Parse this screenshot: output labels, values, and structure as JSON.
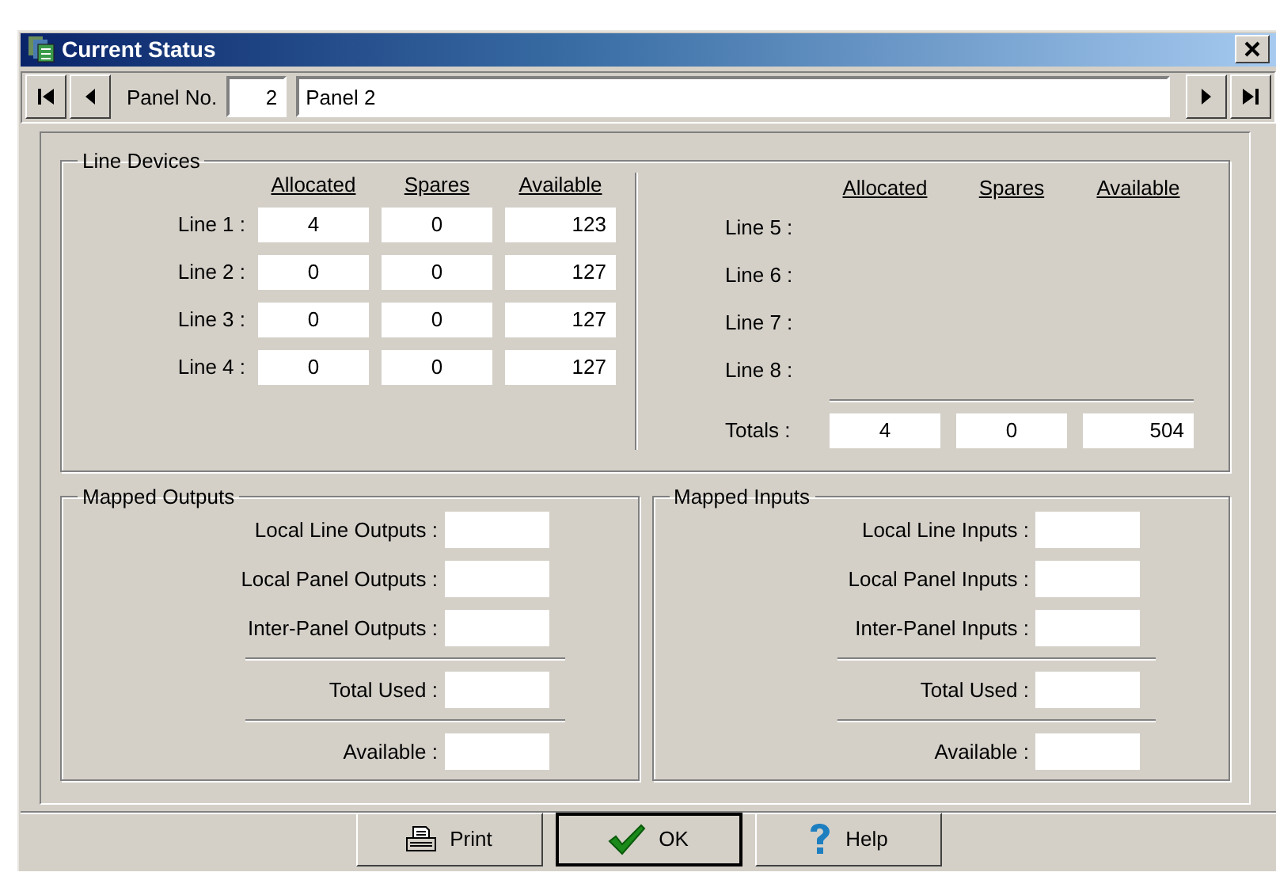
{
  "window": {
    "title": "Current Status"
  },
  "navigator": {
    "label": "Panel No.",
    "number": "2",
    "name": "Panel 2"
  },
  "line_devices": {
    "title": "Line Devices",
    "columns_left": [
      "Allocated",
      "Spares",
      "Available"
    ],
    "lines_left": [
      {
        "label": "Line 1 :",
        "values": [
          "4",
          "0",
          "123"
        ]
      },
      {
        "label": "Line 2 :",
        "values": [
          "0",
          "0",
          "127"
        ]
      },
      {
        "label": "Line 3 :",
        "values": [
          "0",
          "0",
          "127"
        ]
      },
      {
        "label": "Line 4 :",
        "values": [
          "0",
          "0",
          "127"
        ]
      }
    ],
    "columns_right": [
      "Allocated",
      "Spares",
      "Available"
    ],
    "lines_right": [
      {
        "label": "Line 5 :"
      },
      {
        "label": "Line 6 :"
      },
      {
        "label": "Line 7 :"
      },
      {
        "label": "Line 8 :"
      }
    ],
    "totals": {
      "label": "Totals :",
      "values": [
        "4",
        "0",
        "504"
      ]
    }
  },
  "mapped_outputs": {
    "title": "Mapped Outputs",
    "rows": [
      {
        "label": "Local Line Outputs :",
        "kind": "item"
      },
      {
        "label": "Local Panel Outputs :",
        "kind": "item"
      },
      {
        "label": "Inter-Panel Outputs :",
        "kind": "item"
      },
      {
        "label": "Total Used :",
        "kind": "total"
      },
      {
        "label": "Available :",
        "kind": "total"
      }
    ]
  },
  "mapped_inputs": {
    "title": "Mapped Inputs",
    "rows": [
      {
        "label": "Local Line Inputs :",
        "kind": "item"
      },
      {
        "label": "Local Panel Inputs :",
        "kind": "item"
      },
      {
        "label": "Inter-Panel Inputs :",
        "kind": "item"
      },
      {
        "label": "Total Used :",
        "kind": "total"
      },
      {
        "label": "Available :",
        "kind": "total"
      }
    ]
  },
  "buttons": [
    {
      "label": "Print",
      "kind": "print",
      "default": false
    },
    {
      "label": "OK",
      "kind": "ok",
      "default": true
    },
    {
      "label": "Help",
      "kind": "help",
      "default": false
    }
  ]
}
